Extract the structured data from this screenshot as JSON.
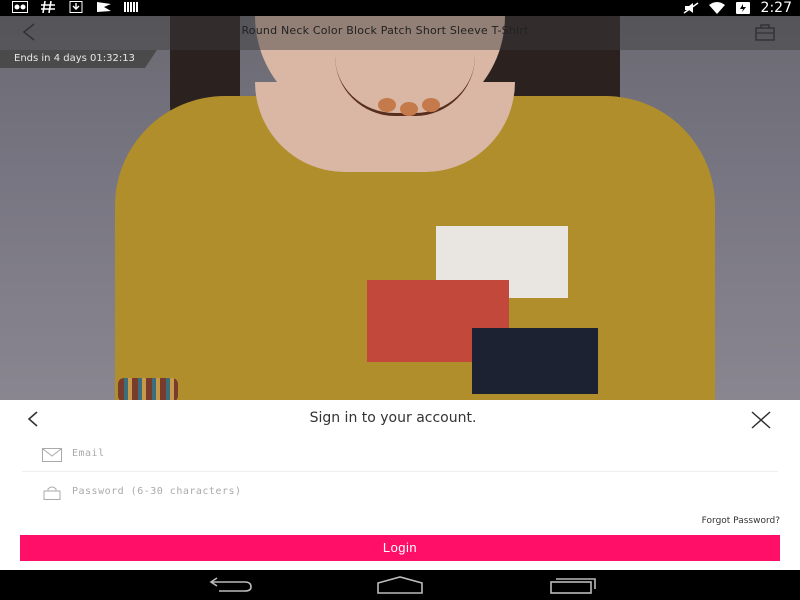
{
  "status_bar": {
    "time": "2:27",
    "icons": [
      "photo-icon",
      "hash-icon",
      "download-icon",
      "flag-icon",
      "barcode-icon",
      "silent-icon",
      "wifi-icon",
      "battery-icon"
    ]
  },
  "header": {
    "title": "Round Neck Color Block Patch Short Sleeve T-Shirt",
    "countdown": "Ends in 4 days 01:32:13"
  },
  "signin": {
    "title": "Sign in to your account.",
    "email_placeholder": "Email",
    "password_placeholder": "Password (6-30 characters)",
    "forgot_label": "Forgot Password?",
    "login_label": "Login"
  },
  "colors": {
    "accent": "#ff0f67"
  }
}
